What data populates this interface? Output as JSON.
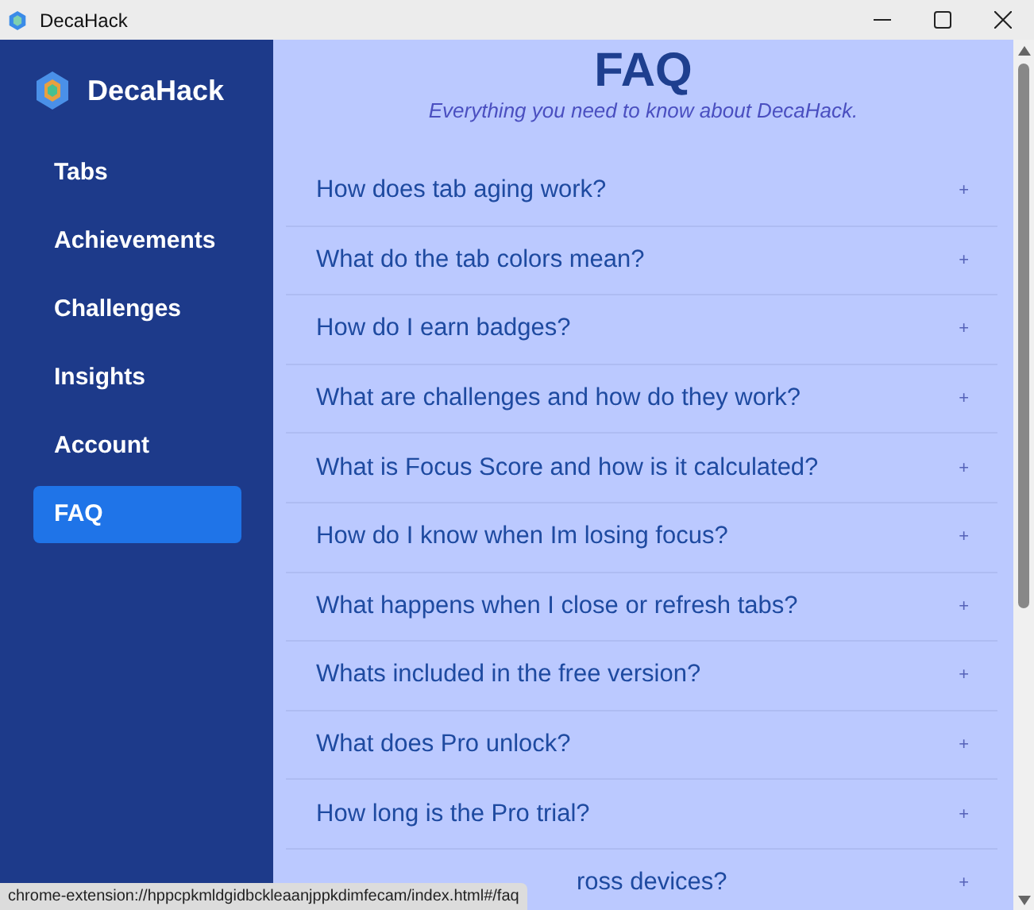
{
  "window": {
    "title": "DecaHack"
  },
  "sidebar": {
    "brand": "DecaHack",
    "items": [
      {
        "label": "Tabs",
        "selected": false
      },
      {
        "label": "Achievements",
        "selected": false
      },
      {
        "label": "Challenges",
        "selected": false
      },
      {
        "label": "Insights",
        "selected": false
      },
      {
        "label": "Account",
        "selected": false
      },
      {
        "label": "FAQ",
        "selected": true
      }
    ]
  },
  "header": {
    "title": "FAQ",
    "subtitle": "Everything you need to know about DecaHack."
  },
  "faq": [
    {
      "question": "How does tab aging work?",
      "icon": "+",
      "expanded": false
    },
    {
      "question": "What do the tab colors mean?",
      "icon": "+",
      "expanded": false
    },
    {
      "question": "How do I earn badges?",
      "icon": "+",
      "expanded": false
    },
    {
      "question": "What are challenges and how do they work?",
      "icon": "+",
      "expanded": false
    },
    {
      "question": "What is Focus Score and how is it calculated?",
      "icon": "+",
      "expanded": false
    },
    {
      "question": "How do I know when Im losing focus?",
      "icon": "+",
      "expanded": false
    },
    {
      "question": "What happens when I close or refresh tabs?",
      "icon": "+",
      "expanded": false
    },
    {
      "question": "Whats included in the free version?",
      "icon": "+",
      "expanded": false
    },
    {
      "question": "What does Pro unlock?",
      "icon": "+",
      "expanded": false
    },
    {
      "question": "How long is the Pro trial?",
      "icon": "+",
      "expanded": false
    },
    {
      "question": "ross devices?",
      "icon": "+",
      "expanded": false,
      "kind": "covered"
    }
  ],
  "status_bar": {
    "url": "chrome-extension://hppcpkmldgidbckleaanjppkdimfecam/index.html#/faq"
  }
}
